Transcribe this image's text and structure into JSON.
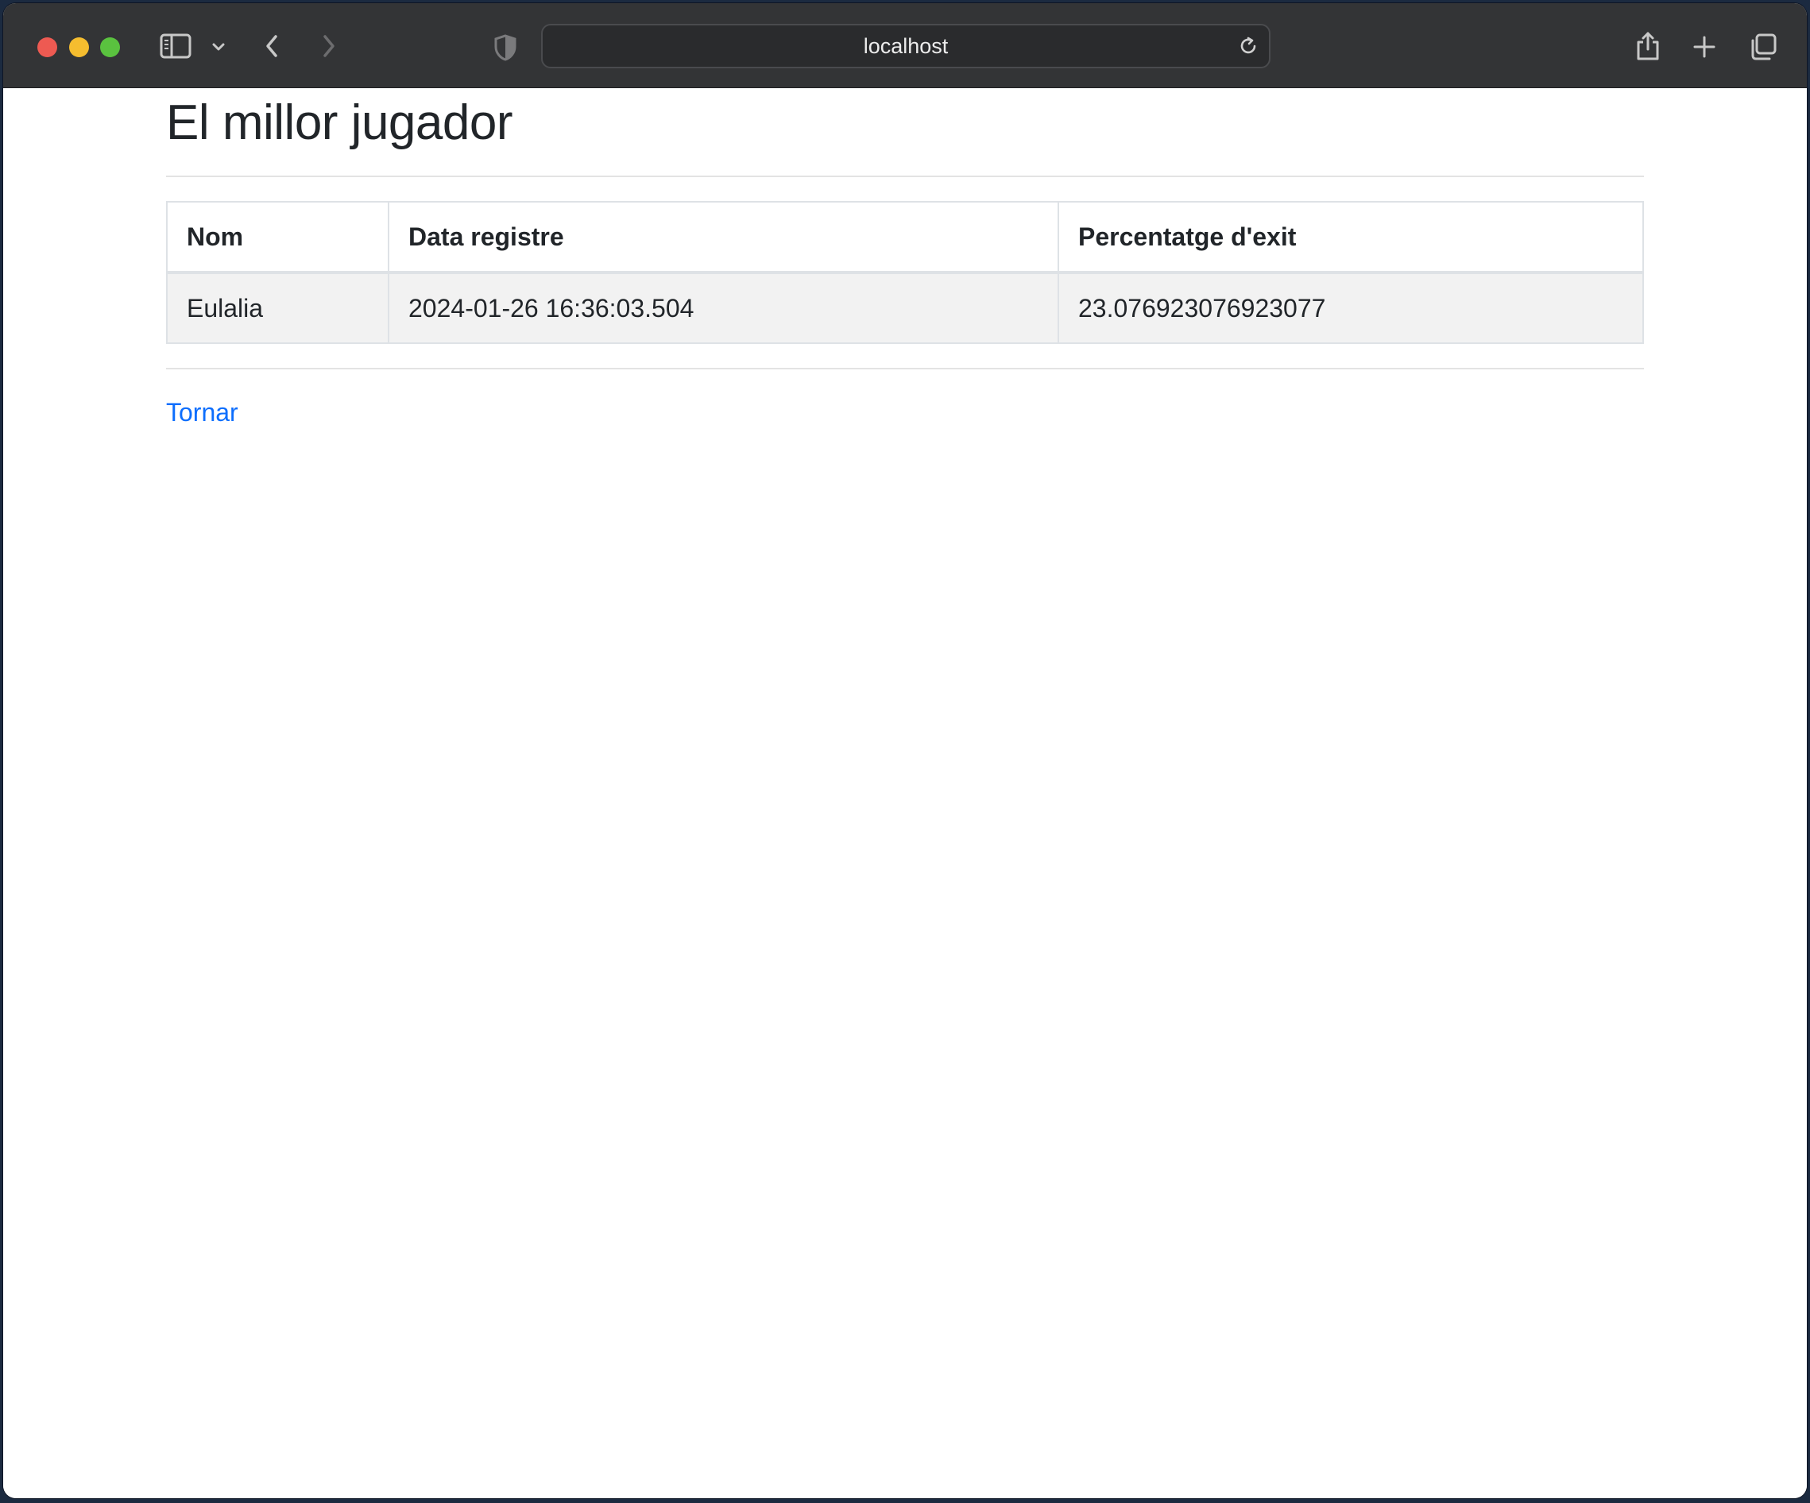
{
  "browser": {
    "url": "localhost",
    "traffic_lights": {
      "close_color": "#ee5a52",
      "minimize_color": "#f5bd2f",
      "zoom_color": "#5ac23f"
    },
    "icons": {
      "sidebar": "sidebar-icon",
      "sidebar_menu": "chevron-down-icon",
      "back": "chevron-left-icon",
      "forward": "chevron-right-icon",
      "privacy": "shield-icon",
      "reload": "reload-icon",
      "share": "share-icon",
      "new_tab": "plus-icon",
      "tabs": "tab-overview-icon"
    }
  },
  "page": {
    "title": "El millor jugador",
    "table": {
      "headers": [
        "Nom",
        "Data registre",
        "Percentatge d'exit"
      ],
      "rows": [
        [
          "Eulalia",
          "2024-01-26 16:36:03.504",
          "23.076923076923077"
        ]
      ]
    },
    "back_link": "Tornar",
    "link_color": "#0d6efd"
  }
}
